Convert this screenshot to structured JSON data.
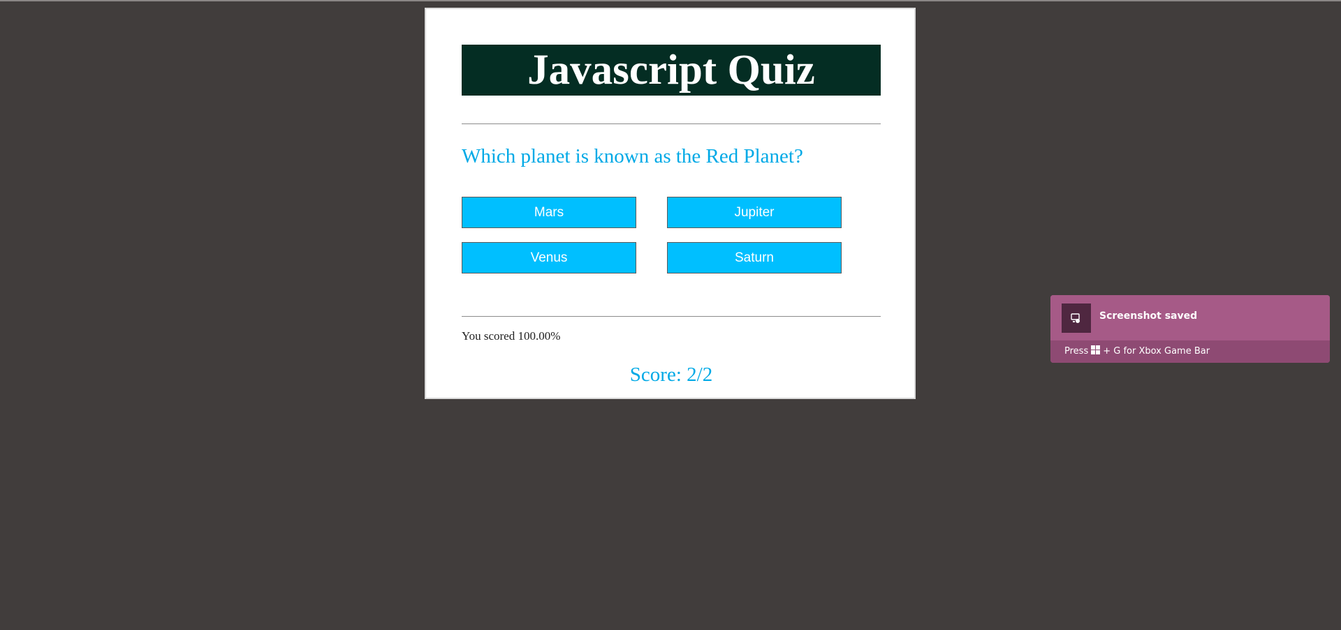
{
  "quiz": {
    "title": "Javascript Quiz",
    "question": "Which planet is known as the Red Planet?",
    "answers": [
      "Mars",
      "Jupiter",
      "Venus",
      "Saturn"
    ],
    "result_text": "You scored 100.00%",
    "score_text": "Score: 2/2"
  },
  "toast": {
    "title": "Screenshot saved",
    "hint_prefix": "Press",
    "hint_suffix": "+ G for Xbox Game Bar"
  },
  "colors": {
    "background": "#413d3c",
    "title_bar": "#042d23",
    "accent": "#00a9e6",
    "button": "#00bfff",
    "toast": "#a65a87",
    "toast_footer": "#8e4a73"
  },
  "icons": {
    "toast_icon": "game-bar-capture-icon",
    "windows_key": "windows-logo-icon"
  }
}
